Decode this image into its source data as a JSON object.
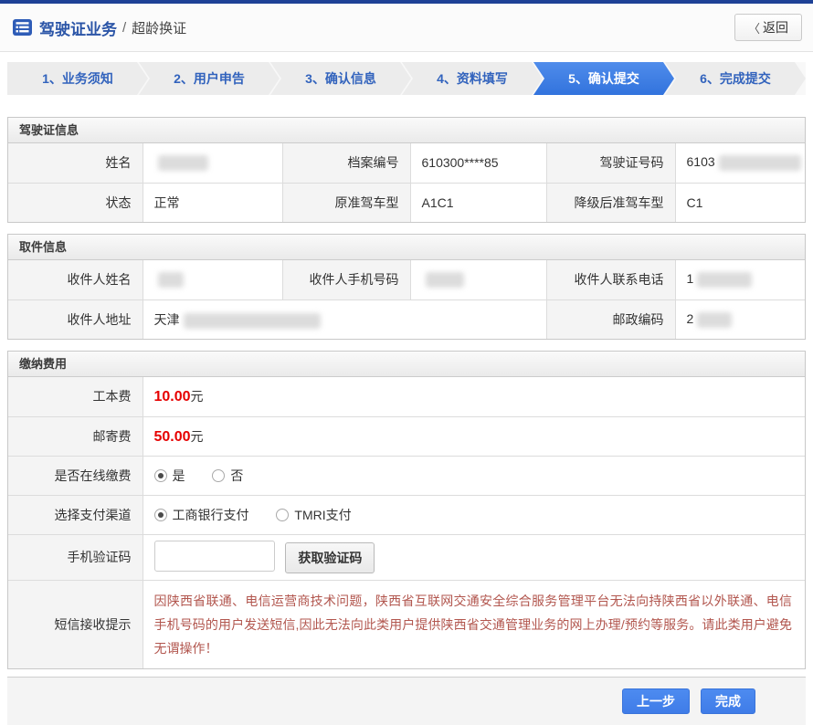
{
  "header": {
    "title": "驾驶证业务",
    "separator": "/",
    "subtitle": "超龄换证",
    "back_chevron": "〈",
    "back_label": "返回"
  },
  "steps": {
    "active_index": 4,
    "items": [
      {
        "label": "1、业务须知"
      },
      {
        "label": "2、用户申告"
      },
      {
        "label": "3、确认信息"
      },
      {
        "label": "4、资料填写"
      },
      {
        "label": "5、确认提交"
      },
      {
        "label": "6、完成提交"
      }
    ]
  },
  "license": {
    "title": "驾驶证信息",
    "fields": {
      "name": {
        "label": "姓名",
        "value": "",
        "redacted": true
      },
      "file": {
        "label": "档案编号",
        "value": "610300****85",
        "redacted": false
      },
      "number": {
        "label": "驾驶证号码",
        "value": "6103",
        "redacted": true
      },
      "status": {
        "label": "状态",
        "value": "正常",
        "redacted": false
      },
      "original": {
        "label": "原准驾车型",
        "value": "A1C1",
        "redacted": false
      },
      "downgrade": {
        "label": "降级后准驾车型",
        "value": "C1",
        "redacted": false
      }
    }
  },
  "pickup": {
    "title": "取件信息",
    "fields": {
      "recipient_name": {
        "label": "收件人姓名",
        "value": "",
        "redacted": true
      },
      "recipient_mobile": {
        "label": "收件人手机号码",
        "value": "",
        "redacted": true
      },
      "recipient_phone": {
        "label": "收件人联系电话",
        "value": "1",
        "redacted": true
      },
      "recipient_addr": {
        "label": "收件人地址",
        "value": "天津",
        "redacted": true
      },
      "postal_code": {
        "label": "邮政编码",
        "value": "2",
        "redacted": true
      }
    }
  },
  "payment": {
    "title": "缴纳费用",
    "production_fee": {
      "label": "工本费",
      "amount": "10.00",
      "unit": "元"
    },
    "mailing_fee": {
      "label": "邮寄费",
      "amount": "50.00",
      "unit": "元"
    },
    "pay_online": {
      "label": "是否在线缴费",
      "options": [
        {
          "label": "是",
          "selected": true
        },
        {
          "label": "否",
          "selected": false
        }
      ]
    },
    "pay_channel": {
      "label": "选择支付渠道",
      "options": [
        {
          "label": "工商银行支付",
          "selected": true
        },
        {
          "label": "TMRI支付",
          "selected": false
        }
      ]
    },
    "sms_code": {
      "label": "手机验证码",
      "value": "",
      "button_label": "获取验证码"
    },
    "sms_notice": {
      "label": "短信接收提示",
      "text": "因陕西省联通、电信运营商技术问题，陕西省互联网交通安全综合服务管理平台无法向持陕西省以外联通、电信手机号码的用户发送短信,因此无法向此类用户提供陕西省交通管理业务的网上办理/预约等服务。请此类用户避免无谓操作！"
    }
  },
  "footer": {
    "prev_label": "上一步",
    "finish_label": "完成"
  },
  "colors": {
    "topbar_navy": "#1e4196",
    "title_blue": "#2b55a7",
    "step_active_blue": "#3e7fe2",
    "step_text_blue": "#3263bd",
    "fee_red": "#e60000",
    "notice_red": "#b2564e",
    "button_blue": "#4486ef"
  }
}
